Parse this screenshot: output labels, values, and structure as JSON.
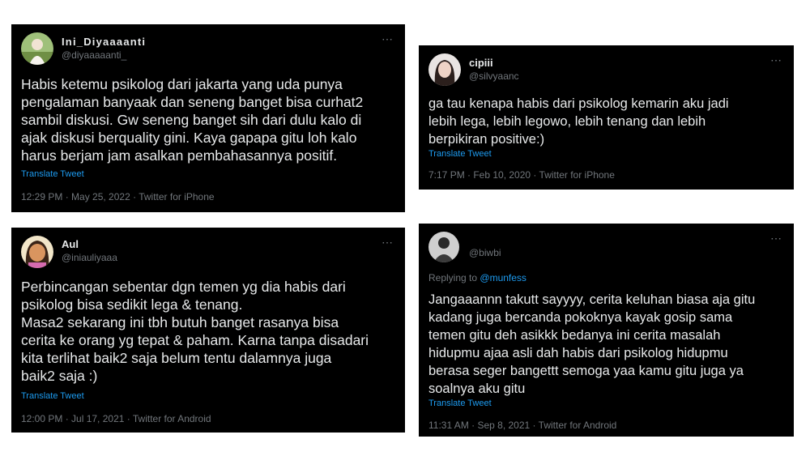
{
  "colors": {
    "card_bg": "#000000",
    "text": "#e7e9ea",
    "muted": "#71767b",
    "link": "#1d9bf0",
    "page_bg": "#ffffff"
  },
  "more_icon": "⋯",
  "tweets": [
    {
      "name": "Ini_Diyaaaanti",
      "handle": "@diyaaaaanti_",
      "text": "Habis ketemu psikolog dari jakarta yang uda punya\npengalaman banyaak dan seneng banget bisa curhat2\nsambil diskusi. Gw seneng banget sih dari dulu kalo di\najak diskusi berquality  gini. Kaya gapapa gitu loh kalo\nharus berjam jam asalkan pembahasannya positif.",
      "translate": "Translate Tweet",
      "timestamp": "12:29 PM · May 25, 2022 · Twitter for iPhone"
    },
    {
      "name": "cipiii",
      "handle": "@silvyaanc",
      "text": "ga tau kenapa habis dari psikolog kemarin aku jadi\nlebih lega, lebih legowo, lebih tenang dan lebih\nberpikiran positive:)",
      "translate": "Translate Tweet",
      "timestamp": "7:17 PM · Feb 10, 2020 · Twitter for iPhone"
    },
    {
      "name": "Aul",
      "handle": "@iniauliyaaa",
      "text": "Perbincangan sebentar dgn temen yg dia habis dari\npsikolog bisa sedikit lega & tenang.\nMasa2 sekarang ini tbh butuh banget rasanya bisa\ncerita ke orang yg tepat & paham. Karna tanpa disadari\nkita terlihat baik2 saja belum tentu dalamnya juga\nbaik2 saja :)",
      "translate": "Translate Tweet",
      "timestamp": "12:00 PM · Jul 17, 2021 · Twitter for Android"
    },
    {
      "name": "",
      "handle": "@biwbi",
      "replying_prefix": "Replying to",
      "replying_to": "@munfess",
      "text": "Jangaaannn takutt sayyyy, cerita keluhan biasa aja gitu\nkadang juga bercanda pokoknya kayak gosip sama\ntemen gitu deh asikkk bedanya ini cerita masalah\nhidupmu ajaa asli dah habis dari psikolog hidupmu\nberasa seger bangettt semoga yaa kamu gitu juga ya\nsoalnya aku gitu",
      "translate": "Translate Tweet",
      "timestamp": "11:31 AM · Sep 8, 2021 · Twitter for Android"
    }
  ]
}
